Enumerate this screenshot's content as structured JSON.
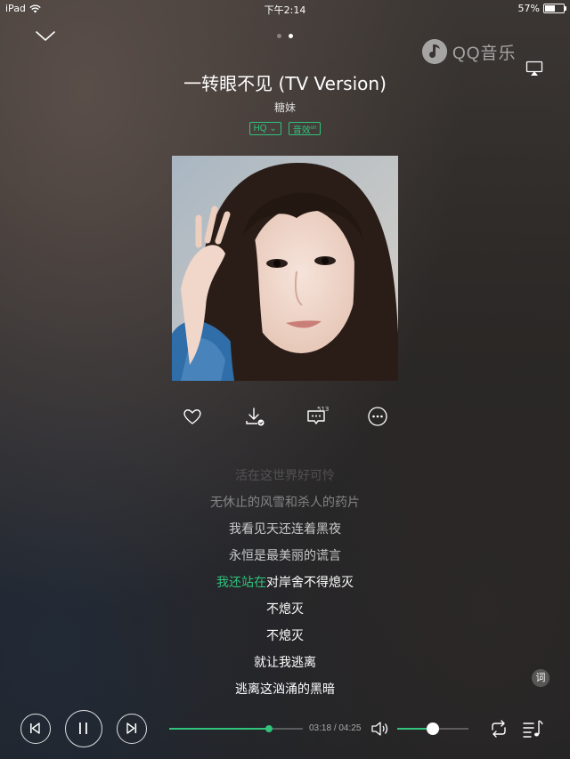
{
  "status_bar": {
    "device": "iPad",
    "time": "下午2:14",
    "battery": "57%",
    "battery_level": 0.57
  },
  "header": {
    "page_indicator": {
      "count": 2,
      "active": 2
    },
    "logo_text": "QQ音乐"
  },
  "song": {
    "title": "一转眼不见 (TV Version)",
    "artist": "糖妹",
    "quality_badge": "HQ",
    "effect_badge": "音效",
    "effect_state": "on"
  },
  "actions": {
    "comment_count": "513"
  },
  "lyrics": [
    {
      "text": "活在这世界好可怜",
      "state": "faded"
    },
    {
      "text": "无休止的风雪和杀人的药片",
      "state": "dim"
    },
    {
      "text": "我看见天还连着黑夜",
      "state": "mid"
    },
    {
      "text": "永恒是最美丽的谎言",
      "state": "mid"
    },
    {
      "played": "我还站在",
      "rest": "对岸舍不得熄灭",
      "state": "current"
    },
    {
      "text": "不熄灭",
      "state": "normal"
    },
    {
      "text": "不熄灭",
      "state": "normal"
    },
    {
      "text": "就让我逃离",
      "state": "bright"
    },
    {
      "text": "逃离这汹涌的黑暗",
      "state": "bright"
    }
  ],
  "lyrics_button": "词",
  "playback": {
    "elapsed": "03:18",
    "duration": "04:25",
    "progress": 0.747,
    "volume": 0.5
  },
  "colors": {
    "accent": "#31c27c"
  }
}
